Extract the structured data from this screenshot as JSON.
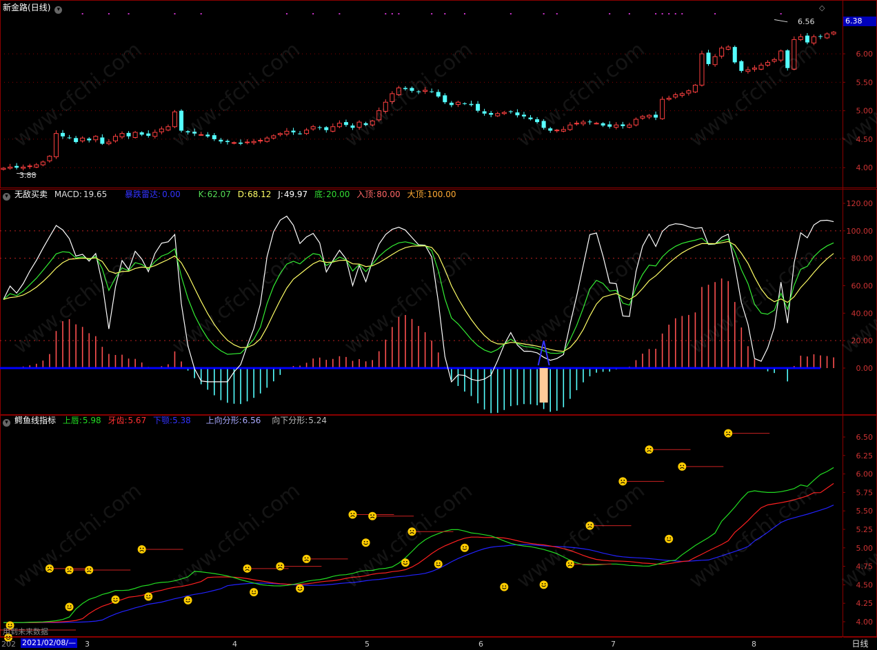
{
  "colors": {
    "up": "#ff4040",
    "down": "#54ffff",
    "grid": "#8b0000",
    "axis_text": "#cc3333",
    "k": "#ffffff",
    "d": "#33ee33",
    "j": "#ffff66",
    "macd_up": "#ff5050",
    "macd_down": "#54ffff",
    "zero": "#0000ff",
    "lips": "#22dd22",
    "teeth": "#ff2020",
    "jaw": "#2222ff"
  },
  "header": {
    "stock": "新金路",
    "period_tag": "(日线)"
  },
  "panel2": {
    "title": "无敌买卖",
    "macd_label": "MACD:",
    "macd_value": "19.65",
    "signal_label": "暴跌雷达:",
    "signal_value": "0.00",
    "k_label": "K:",
    "k_value": "62.07",
    "d_label": "D:",
    "d_value": "68.12",
    "j_label": "J:",
    "j_value": "49.97",
    "bottom_label": "底:",
    "bottom_value": "20.00",
    "entry_label": "入顶:",
    "entry_value": "80.00",
    "top_label": "大顶:",
    "top_value": "100.00"
  },
  "panel3": {
    "title": "鳄鱼线指标",
    "lips_label": "上唇:",
    "lips_value": "5.98",
    "teeth_label": "牙齿:",
    "teeth_value": "5.67",
    "jaw_label": "下颚:",
    "jaw_value": "5.38",
    "up_frac_label": "上向分形:",
    "up_frac_value": "6.56",
    "down_frac_label": "向下分形:",
    "down_frac_value": "5.24"
  },
  "footer": {
    "future_note": "用到未来数据",
    "selected_date": "2021/02/08/—",
    "left_clip": "202",
    "period_button": "日线",
    "months": [
      "3",
      "4",
      "5",
      "6",
      "7",
      "8"
    ]
  },
  "price_tag": "6.38",
  "watermark": "www.cfchi.com",
  "chart_data": [
    {
      "type": "candlestick",
      "title": "新金路 (日线)",
      "ylim": [
        3.7,
        6.8
      ],
      "yticks": [
        4.0,
        4.5,
        5.0,
        5.5,
        6.0
      ],
      "annotations": [
        {
          "label": "3.88",
          "value": 3.88
        },
        {
          "label": "6.56",
          "value": 6.56
        }
      ],
      "closes": [
        3.99,
        4.01,
        4.0,
        4.01,
        4.03,
        4.05,
        4.1,
        4.2,
        4.6,
        4.55,
        4.52,
        4.45,
        4.52,
        4.48,
        4.55,
        4.42,
        4.45,
        4.55,
        4.6,
        4.55,
        4.62,
        4.58,
        4.56,
        4.62,
        4.68,
        4.72,
        4.98,
        4.65,
        4.62,
        4.6,
        4.58,
        4.55,
        4.5,
        4.46,
        4.45,
        4.44,
        4.42,
        4.45,
        4.46,
        4.48,
        4.52,
        4.56,
        4.6,
        4.64,
        4.62,
        4.6,
        4.66,
        4.72,
        4.7,
        4.66,
        4.72,
        4.78,
        4.75,
        4.7,
        4.8,
        4.75,
        4.82,
        5.0,
        5.15,
        5.3,
        5.4,
        5.38,
        5.35,
        5.33,
        5.36,
        5.33,
        5.25,
        5.15,
        5.1,
        5.15,
        5.12,
        5.1,
        5.0,
        4.95,
        4.93,
        4.95,
        4.97,
        4.98,
        4.92,
        4.9,
        4.85,
        4.8,
        4.7,
        4.65,
        4.66,
        4.67,
        4.75,
        4.78,
        4.8,
        4.8,
        4.78,
        4.74,
        4.72,
        4.75,
        4.73,
        4.75,
        4.85,
        4.9,
        4.92,
        4.88,
        5.2,
        5.22,
        5.28,
        5.3,
        5.35,
        5.45,
        6.0,
        5.82,
        5.95,
        6.1,
        6.12,
        5.85,
        5.7,
        5.72,
        5.75,
        5.8,
        5.85,
        5.9,
        6.05,
        5.75,
        6.25,
        6.3,
        6.2,
        6.3,
        6.3,
        6.35,
        6.38
      ],
      "days": 125
    },
    {
      "type": "line+bar",
      "title": "无敌买卖",
      "ylim": [
        -15,
        125
      ],
      "yticks": [
        0,
        20,
        40,
        60,
        80,
        100,
        120
      ],
      "ref_lines": [
        20,
        80,
        100
      ],
      "series": [
        {
          "name": "K"
        },
        {
          "name": "D"
        },
        {
          "name": "J"
        },
        {
          "name": "MACD"
        }
      ]
    },
    {
      "type": "line",
      "title": "鳄鱼线指标",
      "ylim": [
        3.9,
        6.7
      ],
      "yticks": [
        4.0,
        4.25,
        4.5,
        4.75,
        5.0,
        5.25,
        5.5,
        5.75,
        6.0,
        6.25,
        6.5
      ],
      "series": [
        {
          "name": "上唇"
        },
        {
          "name": "牙齿"
        },
        {
          "name": "下颚"
        }
      ],
      "fractals_up": [
        [
          7,
          4.72
        ],
        [
          10,
          4.7
        ],
        [
          13,
          4.7
        ],
        [
          21,
          4.98
        ],
        [
          37,
          4.72
        ],
        [
          42,
          4.75
        ],
        [
          46,
          4.85
        ],
        [
          53,
          5.45
        ],
        [
          56,
          5.43
        ],
        [
          62,
          5.22
        ],
        [
          86,
          4.78
        ],
        [
          89,
          5.3
        ],
        [
          94,
          5.9
        ],
        [
          98,
          6.33
        ],
        [
          103,
          6.1
        ],
        [
          110,
          6.55
        ]
      ],
      "fractals_down": [
        [
          1,
          3.95
        ],
        [
          10,
          4.2
        ],
        [
          17,
          4.3
        ],
        [
          22,
          4.34
        ],
        [
          28,
          4.29
        ],
        [
          38,
          4.4
        ],
        [
          45,
          4.45
        ],
        [
          55,
          5.07
        ],
        [
          61,
          4.8
        ],
        [
          66,
          4.78
        ],
        [
          70,
          5.0
        ],
        [
          76,
          4.47
        ],
        [
          82,
          4.5
        ],
        [
          101,
          5.12
        ]
      ]
    }
  ]
}
